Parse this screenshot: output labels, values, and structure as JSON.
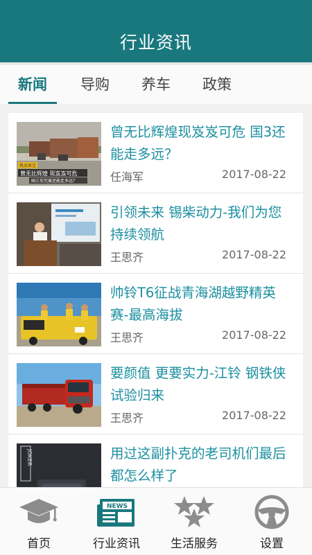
{
  "header": {
    "title": "行业资讯"
  },
  "tabs": [
    {
      "label": "新闻",
      "active": true
    },
    {
      "label": "导购",
      "active": false
    },
    {
      "label": "养车",
      "active": false
    },
    {
      "label": "政策",
      "active": false
    }
  ],
  "articles": [
    {
      "title": "曾无比辉煌现岌岌可危 国3还能走多远？",
      "author": "任海军",
      "date": "2017-08-22",
      "thumb": {
        "tag": "热点关注",
        "caption1": "曾无比辉煌 现岌岌可危",
        "caption2": "国三车究竟还能走多远？"
      }
    },
    {
      "title": "引领未来 锡柴动力-我们为您持续领航",
      "author": "王思齐",
      "date": "2017-08-22"
    },
    {
      "title": "帅铃T6征战青海湖越野精英赛-最高海拔",
      "author": "王思齐",
      "date": "2017-08-22"
    },
    {
      "title": "要颜值 更要实力-江铃 钢铁侠试验归来",
      "author": "王思齐",
      "date": "2017-08-22"
    },
    {
      "title": "用过这副扑克的老司机们最后都怎么样了",
      "author": "",
      "date": "",
      "thumb": {
        "text": "JOKER"
      }
    }
  ],
  "bottom_nav": [
    {
      "label": "首页",
      "icon": "graduation-cap-icon",
      "active": false
    },
    {
      "label": "行业资讯",
      "icon": "newspaper-icon",
      "icon_text": "NEWS",
      "active": true
    },
    {
      "label": "生活服务",
      "icon": "stars-icon",
      "active": false
    },
    {
      "label": "设置",
      "icon": "steering-wheel-icon",
      "active": false
    }
  ],
  "colors": {
    "primary": "#19787d",
    "headline": "#1c8fa0",
    "icon_gray": "#8c8c8c"
  }
}
